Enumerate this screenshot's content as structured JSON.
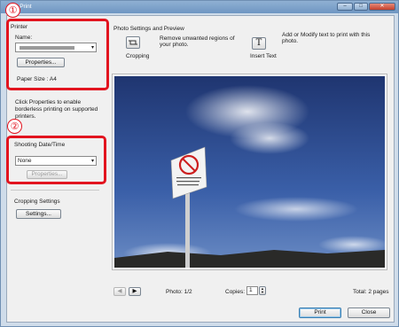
{
  "window": {
    "title": "to Print",
    "controls": {
      "minimize": "–",
      "maximize": "□",
      "close": "✕"
    }
  },
  "printer": {
    "section_label": "Printer",
    "name_label": "Name:",
    "name_value": "",
    "properties_button": "Properties...",
    "paper_size": "Paper Size : A4",
    "note": "Click Properties to enable borderless printing on supported printers."
  },
  "shooting": {
    "section_label": "Shooting Date/Time",
    "select_value": "None",
    "properties_button": "Properties..."
  },
  "cropping": {
    "section_label": "Cropping Settings",
    "settings_button": "Settings..."
  },
  "preview": {
    "section_label": "Photo Settings and Preview",
    "cropping_label": "Cropping",
    "cropping_desc": "Remove unwanted regions of your photo.",
    "insert_text_label": "Insert Text",
    "insert_text_icon": "T",
    "insert_text_desc": "Add or Modify text to print with this photo."
  },
  "navigation": {
    "photo_label": "Photo: 1/2",
    "copies_label": "Copies:",
    "copies_value": "1",
    "total": "Total: 2 pages"
  },
  "buttons": {
    "print": "Print",
    "close": "Close"
  },
  "callouts": {
    "one": "①",
    "two": "②"
  },
  "colors": {
    "callout": "#e2141f",
    "sky": "#2f4f8c"
  }
}
